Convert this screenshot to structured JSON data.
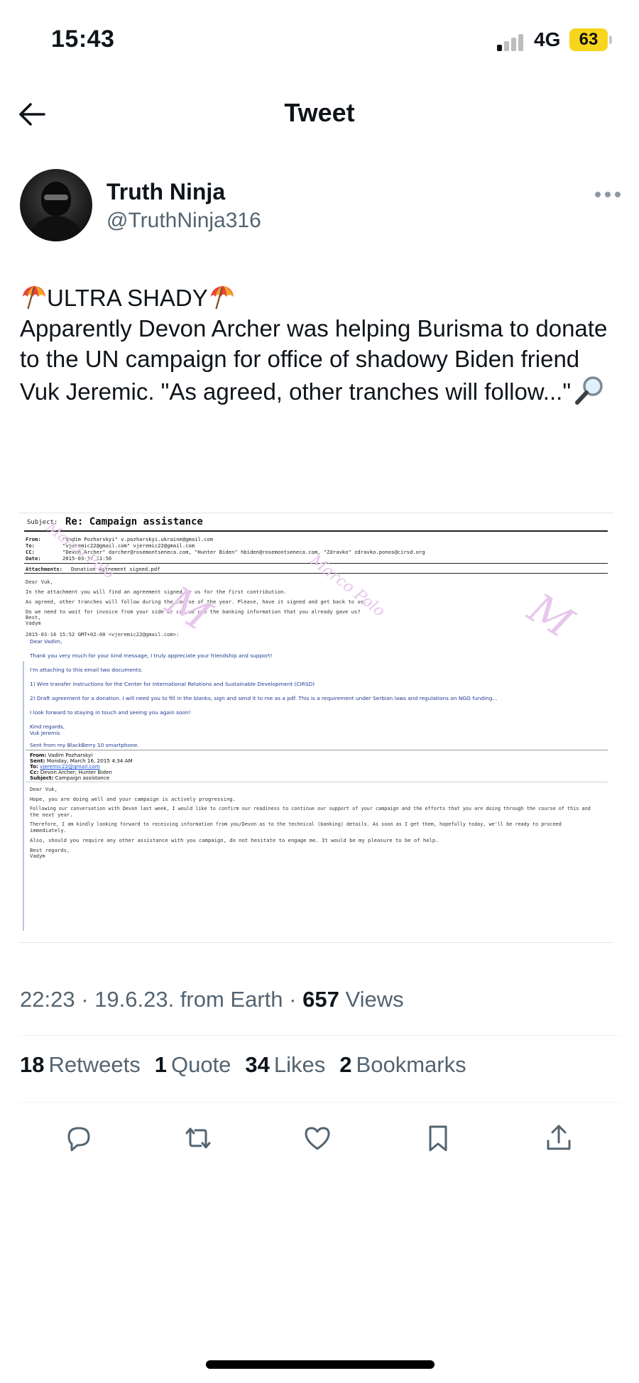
{
  "status_bar": {
    "time": "15:43",
    "network": "4G",
    "battery": "63",
    "battery_color": "#f7d51d"
  },
  "header": {
    "title": "Tweet",
    "back_icon": "arrow-left-icon"
  },
  "author": {
    "name": "Truth Ninja",
    "handle": "@TruthNinja316"
  },
  "tweet": {
    "heading": "ULTRA SHADY",
    "body": "Apparently Devon Archer was helping Burisma to donate to the UN campaign for office of shadowy Biden friend Vuk Jeremic.  \"As agreed, other tranches will follow...\"",
    "emoji": [
      "beach-umbrella-icon",
      "magnifying-glass-icon"
    ]
  },
  "email": {
    "subject_label": "Subject:",
    "subject": "Re: Campaign assistance",
    "headers": [
      {
        "label": "From:",
        "value": "\"Vadim Pozharskyi\" v.pozharskyi.ukraine@gmail.com"
      },
      {
        "label": "To:",
        "value": "\"vjeremic22@gmail.com\" vjeremic22@gmail.com"
      },
      {
        "label": "CC:",
        "value": "\"Devon Archer\" darcher@rosemontseneca.com, \"Hunter Biden\" hbiden@rosemontseneca.com, \"Zdravko\" zdravko.ponos@cirsd.org"
      },
      {
        "label": "Date:",
        "value": "2015-03-17 11:56"
      }
    ],
    "attachments_label": "Attachments:",
    "attachments": "Donation Agreement signed.pdf",
    "body_lines": [
      "Dear Vuk,",
      "In the attachment you will find an agreement signed by us for the first contribution.",
      "As agreed, other tranches will follow during the course of the year. Please, have it signed and get back to us.",
      "Do we need to wait for invoice from your side or can we use the banking information that you already gave us?",
      "Best,",
      "Vadym"
    ],
    "quote_header": "2015-03-16 15:52 GMT+02:00 <vjeremic22@gmail.com>:",
    "quote_lines": [
      "Dear Vadim,",
      "Thank you very much for your kind message, I truly appreciate your friendship and support!",
      "I'm attaching to this email two documents:",
      "1) Wire transfer instructions for the Center for International Relations and Sustainable Development (CIRSD)",
      "2) Draft agreement for a donation. I will need you to fill in the blanks, sign and send it to me as a pdf. This is a requirement under Serbian laws and regulations on NGO funding...",
      "I look forward to staying in touch and seeing you again soon!",
      "Kind regards,",
      "Vuk Jeremic",
      "Sent from my BlackBerry 10 smartphone."
    ],
    "fwd_headers": [
      {
        "label": "From:",
        "value": "Vadim Pozharskyi"
      },
      {
        "label": "Sent:",
        "value": "Monday, March 16, 2015 4:34 AM"
      },
      {
        "label": "To:",
        "value": "vjeremic22@gmail.com"
      },
      {
        "label": "Cc:",
        "value": "Devon Archer; Hunter Biden"
      },
      {
        "label": "Subject:",
        "value": "Campaign assistance"
      }
    ],
    "fwd_lines": [
      "Dear Vuk,",
      "Hope, you are doing well and your campaign is actively progressing.",
      "Following our conversation with Devon last week, I would like to confirm our readiness to continue our support of your campaign and the efforts that you are doing through the course of this and",
      "the next year.",
      "Therefore, I am kindly looking forward to receiving information from you/Devon as to the technical (banking) details. As soon as I get them, hopefully today, we'll be ready to proceed",
      "immediately.",
      "Also, should you require any other assistance with you campaign, do not hesitate to engage me. It would be my pleasure to be of help.",
      "Best regards,",
      "Vadym"
    ],
    "watermark": [
      "Marco Polo",
      "M"
    ]
  },
  "meta": {
    "time": "22:23",
    "date": "19.6.23.",
    "source": "from Earth",
    "views_count": "657",
    "views_label": "Views"
  },
  "stats": [
    {
      "count": "18",
      "label": "Retweets"
    },
    {
      "count": "1",
      "label": "Quote"
    },
    {
      "count": "34",
      "label": "Likes"
    },
    {
      "count": "2",
      "label": "Bookmarks"
    }
  ],
  "actions": [
    "reply-icon",
    "retweet-icon",
    "like-icon",
    "bookmark-icon",
    "share-icon"
  ]
}
